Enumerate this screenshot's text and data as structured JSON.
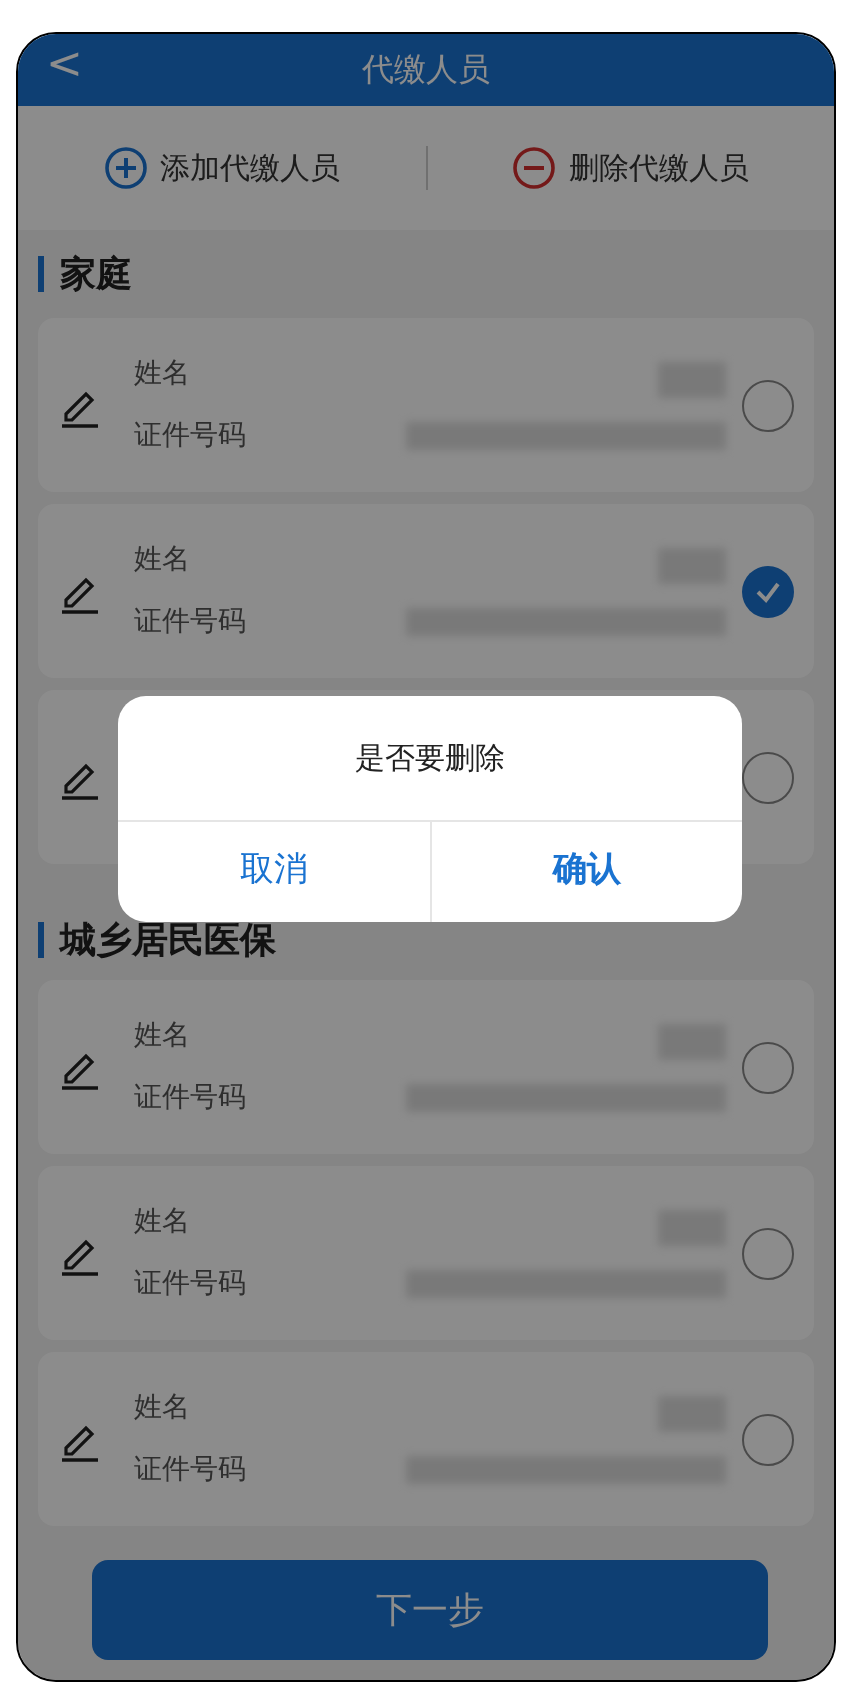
{
  "header": {
    "back": "<",
    "title": "代缴人员"
  },
  "actions": [
    {
      "kind": "add",
      "label": "添加代缴人员"
    },
    {
      "kind": "remove",
      "label": "删除代缴人员"
    }
  ],
  "sections": [
    {
      "title": "家庭",
      "rows": [
        {
          "name_label": "姓名",
          "id_label": "证件号码",
          "selected": false
        },
        {
          "name_label": "姓名",
          "id_label": "证件号码",
          "selected": true
        },
        {
          "selected": false
        }
      ]
    },
    {
      "title": "城乡居民医保",
      "rows": [
        {
          "name_label": "姓名",
          "id_label": "证件号码",
          "selected": false
        },
        {
          "name_label": "姓名",
          "id_label": "证件号码",
          "selected": false
        },
        {
          "name_label": "姓名",
          "id_label": "证件号码",
          "selected": false
        }
      ]
    }
  ],
  "next_button": "下一步",
  "dialog": {
    "message": "是否要删除",
    "buttons": [
      {
        "kind": "cancel",
        "label": "取消"
      },
      {
        "kind": "confirm",
        "label": "确认"
      }
    ]
  }
}
